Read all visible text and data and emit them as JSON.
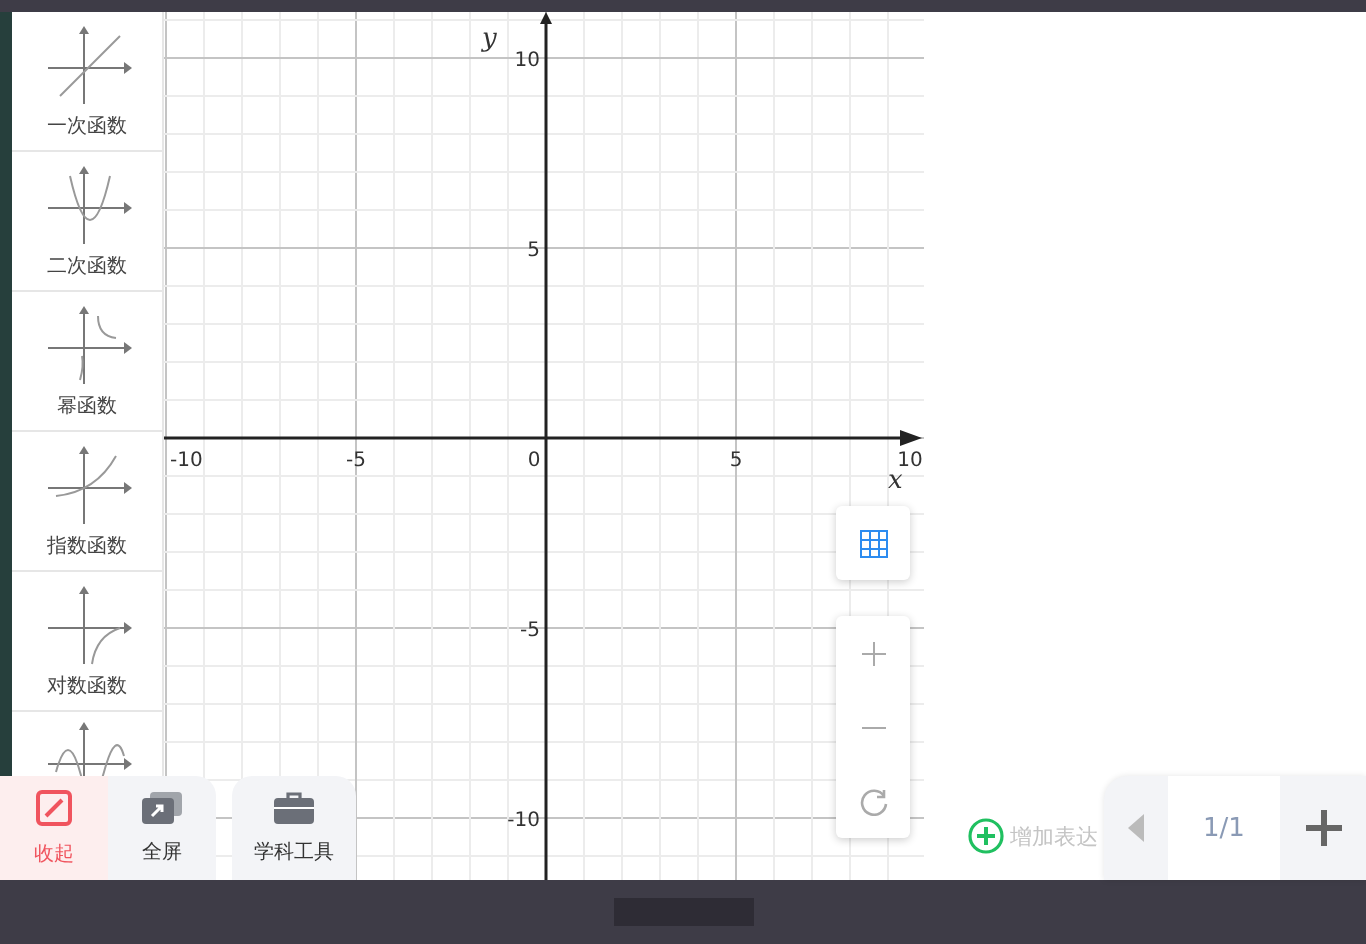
{
  "sidebar": {
    "items": [
      {
        "kind": "linear",
        "label": "一次函数"
      },
      {
        "kind": "quadratic",
        "label": "二次函数"
      },
      {
        "kind": "power",
        "label": "幂函数"
      },
      {
        "kind": "exponential",
        "label": "指数函数"
      },
      {
        "kind": "logarithm",
        "label": "对数函数"
      },
      {
        "kind": "sine"
      }
    ]
  },
  "graph": {
    "x_label": "x",
    "y_label": "y",
    "x_ticks": [
      "-10",
      "-5",
      "0",
      "5",
      "10"
    ],
    "y_ticks": [
      "10",
      "5",
      "-5",
      "-10"
    ]
  },
  "toolbar": [
    {
      "kind": "collapse",
      "label": "收起",
      "selected": true
    },
    {
      "kind": "fullscreen",
      "label": "全屏",
      "selected": false
    },
    {
      "kind": "toolbox",
      "label": "学科工具",
      "selected": false
    }
  ],
  "expression": {
    "placeholder": "增加表达"
  },
  "pager": {
    "page": "1/1"
  }
}
